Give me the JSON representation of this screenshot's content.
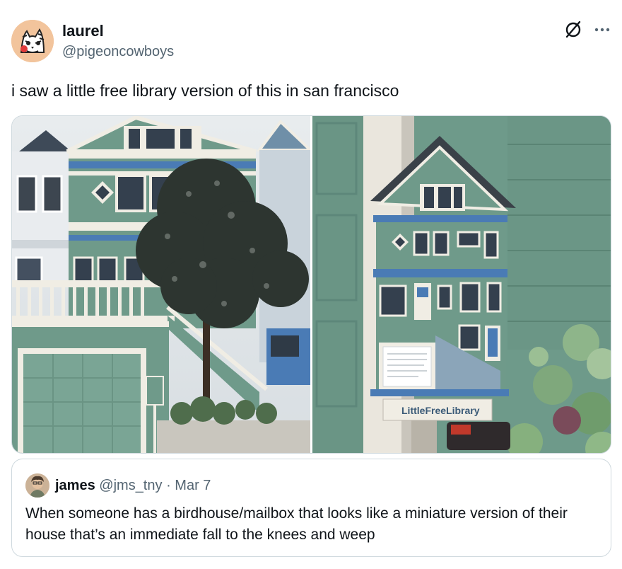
{
  "tweet": {
    "author": {
      "display_name": "laurel",
      "handle": "@pigeoncowboys"
    },
    "text": "i saw a little free library version of this in san francisco",
    "menu": {
      "grok_icon": "grok-icon",
      "more_icon": "more-dots-icon"
    },
    "media": [
      {
        "name": "house-photo"
      },
      {
        "name": "little-free-library-photo",
        "sign_text": "LittleFreeLibrary"
      }
    ]
  },
  "quote": {
    "author": {
      "display_name": "james",
      "handle": "@jms_tny",
      "date": "Mar 7",
      "separator": "·"
    },
    "text": "When someone has a birdhouse/mailbox that looks like a miniature version of their house that’s an immediate fall to the knees and weep"
  },
  "colors": {
    "text_primary": "#0f1419",
    "text_secondary": "#536471",
    "border": "#cfd9de",
    "house_green": "#6f9a8a",
    "trim_blue": "#4a7bb5"
  }
}
